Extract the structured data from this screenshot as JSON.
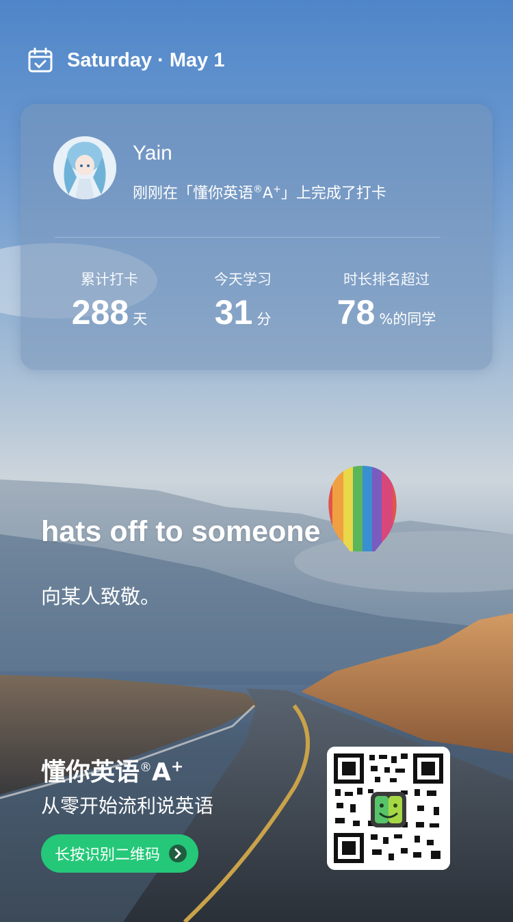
{
  "header": {
    "date": "Saturday · May 1",
    "icon": "calendar-check-icon"
  },
  "card": {
    "username": "Yain",
    "checkin_pre": "刚刚在「懂你英语",
    "checkin_reg": "®",
    "checkin_a": "A",
    "checkin_plus": "+",
    "checkin_post": "」上完成了打卡",
    "stats": [
      {
        "label": "累计打卡",
        "value": "288",
        "unit": "天"
      },
      {
        "label": "今天学习",
        "value": "31",
        "unit": "分"
      },
      {
        "label": "时长排名超过",
        "value": "78",
        "unit": "%的同学"
      }
    ]
  },
  "phrase": {
    "text": "hats off to someone",
    "translation": "向某人致敬。"
  },
  "footer": {
    "brand_name": "懂你英语",
    "brand_reg": "®",
    "brand_a": "A",
    "brand_plus": "+",
    "slogan": "从零开始流利说英语",
    "cta_label": "长按识别二维码"
  },
  "colors": {
    "cta_green": "#24c878",
    "text": "#ffffff"
  }
}
